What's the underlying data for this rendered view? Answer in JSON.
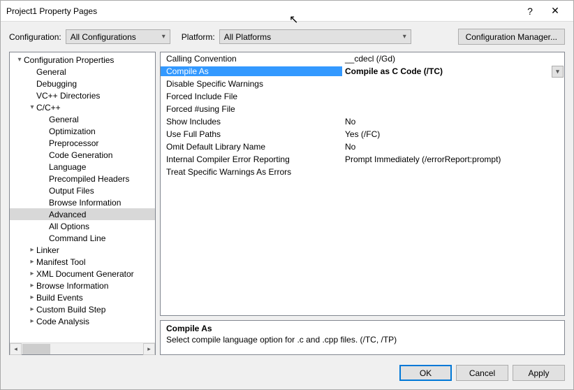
{
  "title": "Project1 Property Pages",
  "config_label": "Configuration:",
  "config_value": "All Configurations",
  "platform_label": "Platform:",
  "platform_value": "All Platforms",
  "cfg_mgr": "Configuration Manager...",
  "tree": [
    {
      "label": "Configuration Properties",
      "depth": 0,
      "exp": "▾"
    },
    {
      "label": "General",
      "depth": 1,
      "exp": ""
    },
    {
      "label": "Debugging",
      "depth": 1,
      "exp": ""
    },
    {
      "label": "VC++ Directories",
      "depth": 1,
      "exp": ""
    },
    {
      "label": "C/C++",
      "depth": 1,
      "exp": "▾"
    },
    {
      "label": "General",
      "depth": 2,
      "exp": ""
    },
    {
      "label": "Optimization",
      "depth": 2,
      "exp": ""
    },
    {
      "label": "Preprocessor",
      "depth": 2,
      "exp": ""
    },
    {
      "label": "Code Generation",
      "depth": 2,
      "exp": ""
    },
    {
      "label": "Language",
      "depth": 2,
      "exp": ""
    },
    {
      "label": "Precompiled Headers",
      "depth": 2,
      "exp": ""
    },
    {
      "label": "Output Files",
      "depth": 2,
      "exp": ""
    },
    {
      "label": "Browse Information",
      "depth": 2,
      "exp": ""
    },
    {
      "label": "Advanced",
      "depth": 2,
      "exp": "",
      "selected": true
    },
    {
      "label": "All Options",
      "depth": 2,
      "exp": ""
    },
    {
      "label": "Command Line",
      "depth": 2,
      "exp": ""
    },
    {
      "label": "Linker",
      "depth": 1,
      "exp": "▸"
    },
    {
      "label": "Manifest Tool",
      "depth": 1,
      "exp": "▸"
    },
    {
      "label": "XML Document Generator",
      "depth": 1,
      "exp": "▸"
    },
    {
      "label": "Browse Information",
      "depth": 1,
      "exp": "▸"
    },
    {
      "label": "Build Events",
      "depth": 1,
      "exp": "▸"
    },
    {
      "label": "Custom Build Step",
      "depth": 1,
      "exp": "▸"
    },
    {
      "label": "Code Analysis",
      "depth": 1,
      "exp": "▸"
    }
  ],
  "props": [
    {
      "name": "Calling Convention",
      "value": "__cdecl (/Gd)"
    },
    {
      "name": "Compile As",
      "value": "Compile as C Code (/TC)",
      "selected": true,
      "dropdown": true
    },
    {
      "name": "Disable Specific Warnings",
      "value": ""
    },
    {
      "name": "Forced Include File",
      "value": ""
    },
    {
      "name": "Forced #using File",
      "value": ""
    },
    {
      "name": "Show Includes",
      "value": "No"
    },
    {
      "name": "Use Full Paths",
      "value": "Yes (/FC)"
    },
    {
      "name": "Omit Default Library Name",
      "value": "No"
    },
    {
      "name": "Internal Compiler Error Reporting",
      "value": "Prompt Immediately (/errorReport:prompt)"
    },
    {
      "name": "Treat Specific Warnings As Errors",
      "value": ""
    }
  ],
  "desc": {
    "title": "Compile As",
    "text": "Select compile language option for .c and .cpp files.     (/TC, /TP)"
  },
  "buttons": {
    "ok": "OK",
    "cancel": "Cancel",
    "apply": "Apply"
  }
}
